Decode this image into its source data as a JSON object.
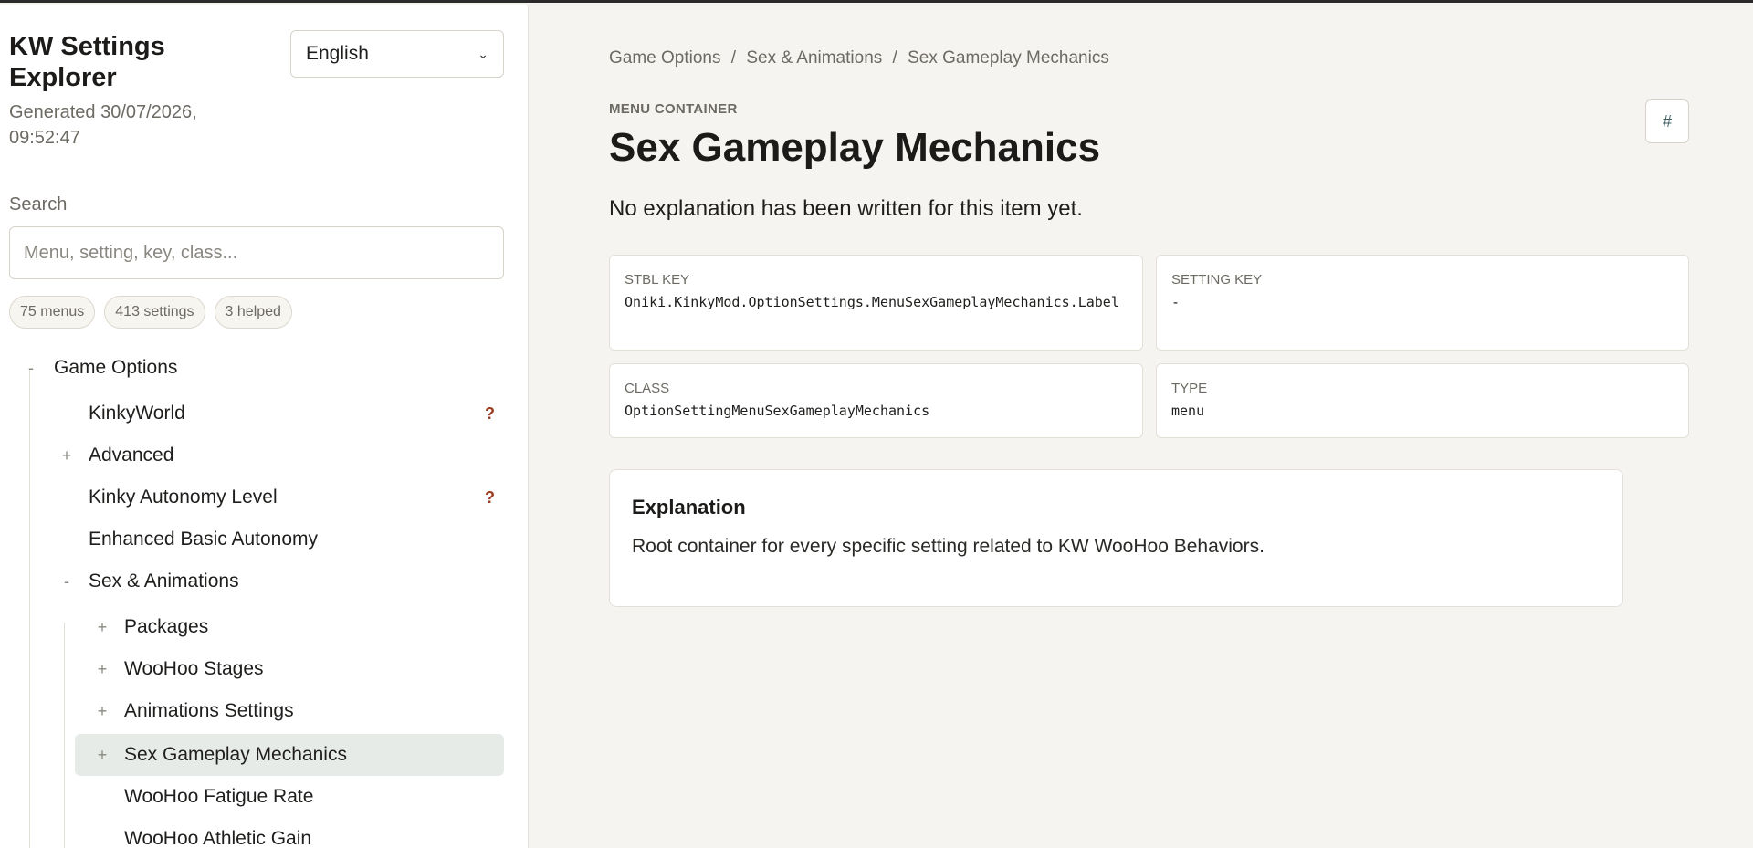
{
  "sidebar": {
    "title": "KW Settings Explorer",
    "generated": "Generated 30/07/2026, 09:52:47",
    "language": "English",
    "search_label": "Search",
    "search_placeholder": "Menu, setting, key, class...",
    "chips": [
      "75 menus",
      "413 settings",
      "3 helped"
    ],
    "tree": [
      {
        "toggle": "-",
        "label": "Game Options",
        "level": 0,
        "help": ""
      },
      {
        "toggle": "",
        "label": "KinkyWorld",
        "level": 1,
        "help": "?"
      },
      {
        "toggle": "+",
        "label": "Advanced",
        "level": 1,
        "help": ""
      },
      {
        "toggle": "",
        "label": "Kinky Autonomy Level",
        "level": 1,
        "help": "?"
      },
      {
        "toggle": "",
        "label": "Enhanced Basic Autonomy",
        "level": 1,
        "help": ""
      },
      {
        "toggle": "-",
        "label": "Sex & Animations",
        "level": 1,
        "help": ""
      },
      {
        "toggle": "+",
        "label": "Packages",
        "level": 2,
        "help": ""
      },
      {
        "toggle": "+",
        "label": "WooHoo Stages",
        "level": 2,
        "help": ""
      },
      {
        "toggle": "+",
        "label": "Animations Settings",
        "level": 2,
        "help": ""
      },
      {
        "toggle": "+",
        "label": "Sex Gameplay Mechanics",
        "level": 2,
        "help": "",
        "selected": true
      },
      {
        "toggle": "",
        "label": "WooHoo Fatigue Rate",
        "level": 2,
        "help": ""
      },
      {
        "toggle": "",
        "label": "WooHoo Athletic Gain",
        "level": 2,
        "help": ""
      }
    ]
  },
  "main": {
    "breadcrumb": [
      "Game Options",
      "Sex & Animations",
      "Sex Gameplay Mechanics"
    ],
    "breadcrumb_sep": "/",
    "kind": "MENU CONTAINER",
    "title": "Sex Gameplay Mechanics",
    "anchor": "#",
    "lede": "No explanation has been written for this item yet.",
    "fields": {
      "stbl_key_label": "STBL KEY",
      "stbl_key_value": "Oniki.KinkyMod.OptionSettings.MenuSexGameplayMechanics.Label",
      "setting_key_label": "SETTING KEY",
      "setting_key_value": "-",
      "class_label": "CLASS",
      "class_value": "OptionSettingMenuSexGameplayMechanics",
      "type_label": "TYPE",
      "type_value": "menu"
    },
    "explanation_title": "Explanation",
    "explanation_text": "Root container for every specific setting related to KW WooHoo Behaviors."
  }
}
